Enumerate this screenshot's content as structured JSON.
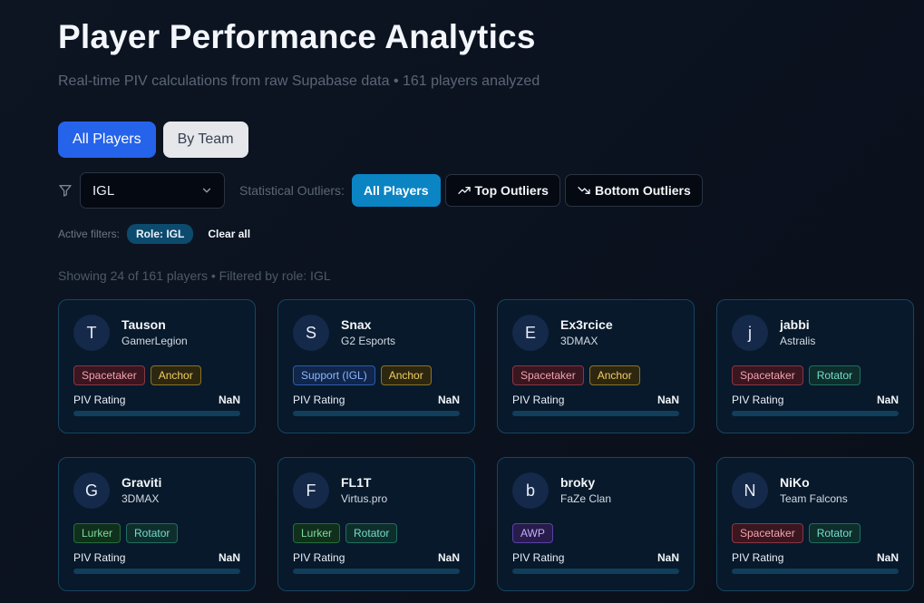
{
  "page": {
    "title": "Player Performance Analytics",
    "subtitle": "Real-time PIV calculations from raw Supabase data • 161 players analyzed"
  },
  "view_tabs": [
    {
      "label": "All Players",
      "active": true
    },
    {
      "label": "By Team",
      "active": false
    }
  ],
  "filters": {
    "filter_icon": "funnel-icon",
    "role_select": {
      "value": "IGL",
      "icon": "chevron-down-icon"
    },
    "outliers_label": "Statistical Outliers:",
    "outlier_buttons": [
      {
        "label": "All Players",
        "active": true,
        "icon": ""
      },
      {
        "label": "Top Outliers",
        "active": false,
        "icon": "trending-up-icon"
      },
      {
        "label": "Bottom Outliers",
        "active": false,
        "icon": "trending-down-icon"
      }
    ]
  },
  "active_filters": {
    "label": "Active filters:",
    "chips": [
      "Role: IGL"
    ],
    "clear_label": "Clear all"
  },
  "showing_text": "Showing 24 of 161 players • Filtered by role: IGL",
  "colors": {
    "primary": "#2563eb",
    "outlier_active": "#0b84c4",
    "card_border": "#17455f",
    "card_bg": "#07192b"
  },
  "players": [
    {
      "initial": "T",
      "name": "Tauson",
      "team": "GamerLegion",
      "tags": [
        {
          "label": "Spacetaker",
          "kind": "spacetaker"
        },
        {
          "label": "Anchor",
          "kind": "anchor"
        }
      ],
      "piv_label": "PIV Rating",
      "piv_value": "NaN"
    },
    {
      "initial": "S",
      "name": "Snax",
      "team": "G2 Esports",
      "tags": [
        {
          "label": "Support (IGL)",
          "kind": "support"
        },
        {
          "label": "Anchor",
          "kind": "anchor"
        }
      ],
      "piv_label": "PIV Rating",
      "piv_value": "NaN"
    },
    {
      "initial": "E",
      "name": "Ex3rcice",
      "team": "3DMAX",
      "tags": [
        {
          "label": "Spacetaker",
          "kind": "spacetaker"
        },
        {
          "label": "Anchor",
          "kind": "anchor"
        }
      ],
      "piv_label": "PIV Rating",
      "piv_value": "NaN"
    },
    {
      "initial": "j",
      "name": "jabbi",
      "team": "Astralis",
      "tags": [
        {
          "label": "Spacetaker",
          "kind": "spacetaker"
        },
        {
          "label": "Rotator",
          "kind": "rotator"
        }
      ],
      "piv_label": "PIV Rating",
      "piv_value": "NaN"
    },
    {
      "initial": "G",
      "name": "Graviti",
      "team": "3DMAX",
      "tags": [
        {
          "label": "Lurker",
          "kind": "lurker"
        },
        {
          "label": "Rotator",
          "kind": "rotator"
        }
      ],
      "piv_label": "PIV Rating",
      "piv_value": "NaN"
    },
    {
      "initial": "F",
      "name": "FL1T",
      "team": "Virtus.pro",
      "tags": [
        {
          "label": "Lurker",
          "kind": "lurker"
        },
        {
          "label": "Rotator",
          "kind": "rotator"
        }
      ],
      "piv_label": "PIV Rating",
      "piv_value": "NaN"
    },
    {
      "initial": "b",
      "name": "broky",
      "team": "FaZe Clan",
      "tags": [
        {
          "label": "AWP",
          "kind": "awp"
        }
      ],
      "piv_label": "PIV Rating",
      "piv_value": "NaN"
    },
    {
      "initial": "N",
      "name": "NiKo",
      "team": "Team Falcons",
      "tags": [
        {
          "label": "Spacetaker",
          "kind": "spacetaker"
        },
        {
          "label": "Rotator",
          "kind": "rotator"
        }
      ],
      "piv_label": "PIV Rating",
      "piv_value": "NaN"
    }
  ]
}
